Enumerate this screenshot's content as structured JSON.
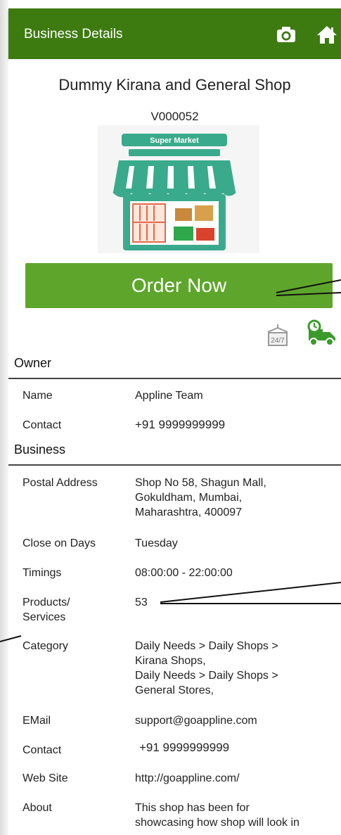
{
  "header": {
    "title": "Business Details",
    "camera_icon": "camera-icon",
    "home_icon": "home-icon"
  },
  "shop": {
    "name": "Dummy Kirana and General Shop",
    "code": "V000052",
    "logo_banner": "Super Market",
    "order_button": "Order Now",
    "badge_247": "24/7"
  },
  "owner": {
    "section_title": "Owner",
    "name_label": "Name",
    "name_value": "Appline Team",
    "contact_label": "Contact",
    "contact_value": "+91 9999999999"
  },
  "business": {
    "section_title": "Business",
    "postal_label": "Postal Address",
    "postal_line1": "Shop No 58, Shagun Mall,",
    "postal_line2": "Gokuldham, Mumbai,",
    "postal_line3": "Maharashtra, 400097",
    "close_label": "Close on Days",
    "close_value": "Tuesday",
    "timings_label": "Timings",
    "timings_value": "08:00:00 - 22:00:00",
    "products_label_1": "Products/",
    "products_label_2": "Services",
    "products_value": "53",
    "category_label": "Category",
    "category_line1": "Daily Needs > Daily Shops >",
    "category_line2": "Kirana Shops,",
    "category_line3": "Daily Needs > Daily Shops >",
    "category_line4": "General Stores,",
    "email_label": "EMail",
    "email_value": "support@goappline.com",
    "contact_label": "Contact",
    "contact_value": "+91 9999999999",
    "website_label": "Web Site",
    "website_value": "http://goappline.com/",
    "about_label": "About",
    "about_line1": "This shop has been for",
    "about_line2": "showcasing how shop will look in"
  },
  "colors": {
    "header_green": "#3d7a10",
    "button_green": "#5ea62b",
    "logo_teal": "#3aaa8c"
  }
}
